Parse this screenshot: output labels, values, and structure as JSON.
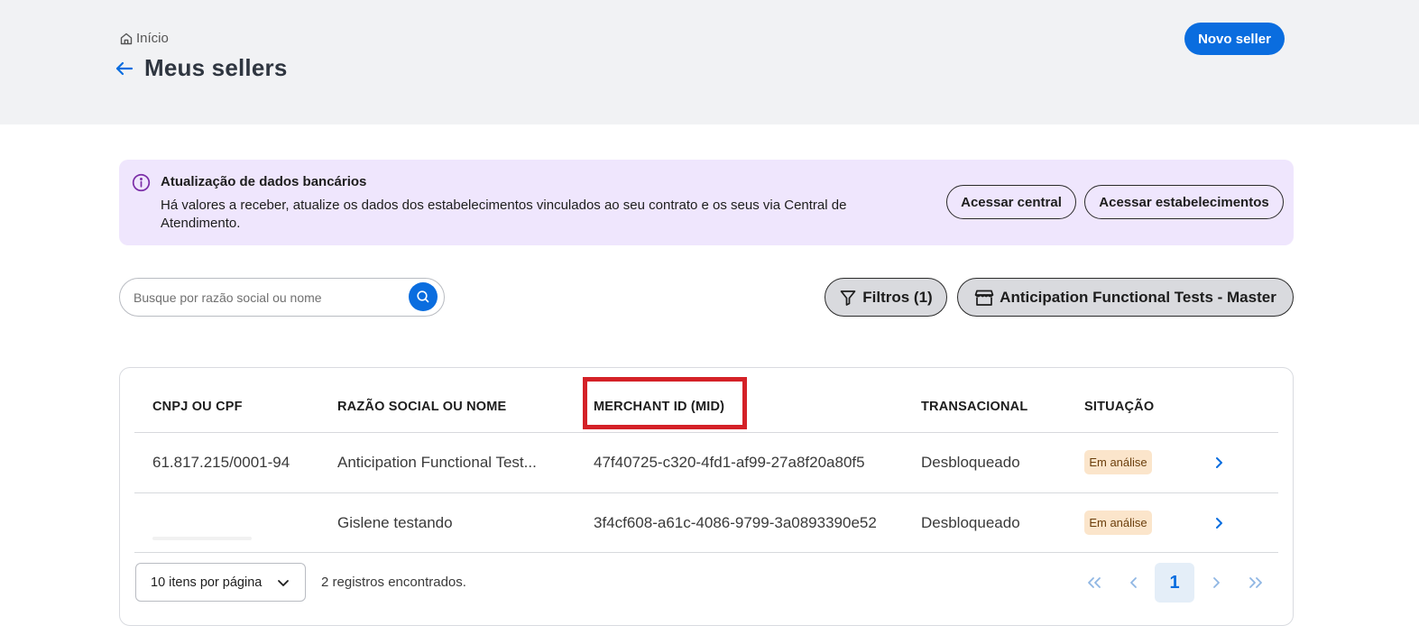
{
  "header": {
    "breadcrumb": "Início",
    "title": "Meus sellers",
    "new_seller_label": "Novo seller"
  },
  "banner": {
    "title": "Atualização de dados bancários",
    "text": "Há valores a receber, atualize os dados dos estabelecimentos vinculados ao seu contrato e os seus via Central de Atendimento.",
    "btn_central": "Acessar central",
    "btn_estab": "Acessar estabelecimentos"
  },
  "search": {
    "placeholder": "Busque por razão social ou nome"
  },
  "filters": {
    "filter_label": "Filtros (1)",
    "store_label": "Anticipation Functional Tests - Master"
  },
  "table": {
    "columns": [
      "CNPJ OU CPF",
      "RAZÃO SOCIAL OU NOME",
      "MERCHANT ID (MID)",
      "TRANSACIONAL",
      "SITUAÇÃO"
    ],
    "rows": [
      {
        "cnpj": "61.817.215/0001-94",
        "name": "Anticipation Functional Test...",
        "mid": "47f40725-c320-4fd1-af99-27a8f20a80f5",
        "transacional": "Desbloqueado",
        "status": "Em análise"
      },
      {
        "cnpj": "",
        "name": "Gislene testando",
        "mid": "3f4cf608-a61c-4086-9799-3a0893390e52",
        "transacional": "Desbloqueado",
        "status": "Em análise"
      }
    ]
  },
  "pagination": {
    "per_page": "10 itens por página",
    "records": "2 registros encontrados.",
    "current_page": "1"
  },
  "colors": {
    "primary": "#0a6ddf",
    "banner_bg": "#efe6fd",
    "badge_bg": "#fbe5cb",
    "highlight": "#d42127"
  }
}
